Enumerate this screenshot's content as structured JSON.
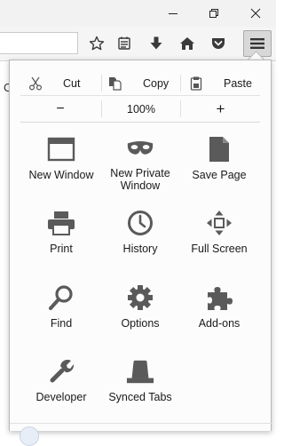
{
  "colors": {
    "icon": "#5a5a5a",
    "panel_bg": "#fcfcfc",
    "panel_border": "#b8b8b8",
    "menu_button_bg": "#d8d8d8"
  },
  "window_controls": {
    "minimize_icon": "minimize-icon",
    "restore_icon": "restore-icon",
    "close_icon": "close-icon"
  },
  "toolbar": {
    "icons": [
      "star-icon",
      "reading-list-icon",
      "download-icon",
      "home-icon",
      "pocket-icon",
      "hamburger-menu-icon"
    ]
  },
  "page": {
    "visible_letter": "C"
  },
  "edit": {
    "cut_label": "Cut",
    "copy_label": "Copy",
    "paste_label": "Paste"
  },
  "zoom": {
    "minus_label": "−",
    "level": "100%",
    "plus_label": "+"
  },
  "menu_items": [
    {
      "label": "New Window",
      "icon": "new-window-icon"
    },
    {
      "label": "New Private\nWindow",
      "icon": "private-mask-icon"
    },
    {
      "label": "Save Page",
      "icon": "save-page-icon"
    },
    {
      "label": "Print",
      "icon": "printer-icon"
    },
    {
      "label": "History",
      "icon": "history-clock-icon"
    },
    {
      "label": "Full Screen",
      "icon": "fullscreen-icon"
    },
    {
      "label": "Find",
      "icon": "magnifier-icon"
    },
    {
      "label": "Options",
      "icon": "gear-icon"
    },
    {
      "label": "Add-ons",
      "icon": "puzzle-icon"
    },
    {
      "label": "Developer",
      "icon": "wrench-icon"
    },
    {
      "label": "Synced Tabs",
      "icon": "synced-tabs-icon"
    }
  ]
}
